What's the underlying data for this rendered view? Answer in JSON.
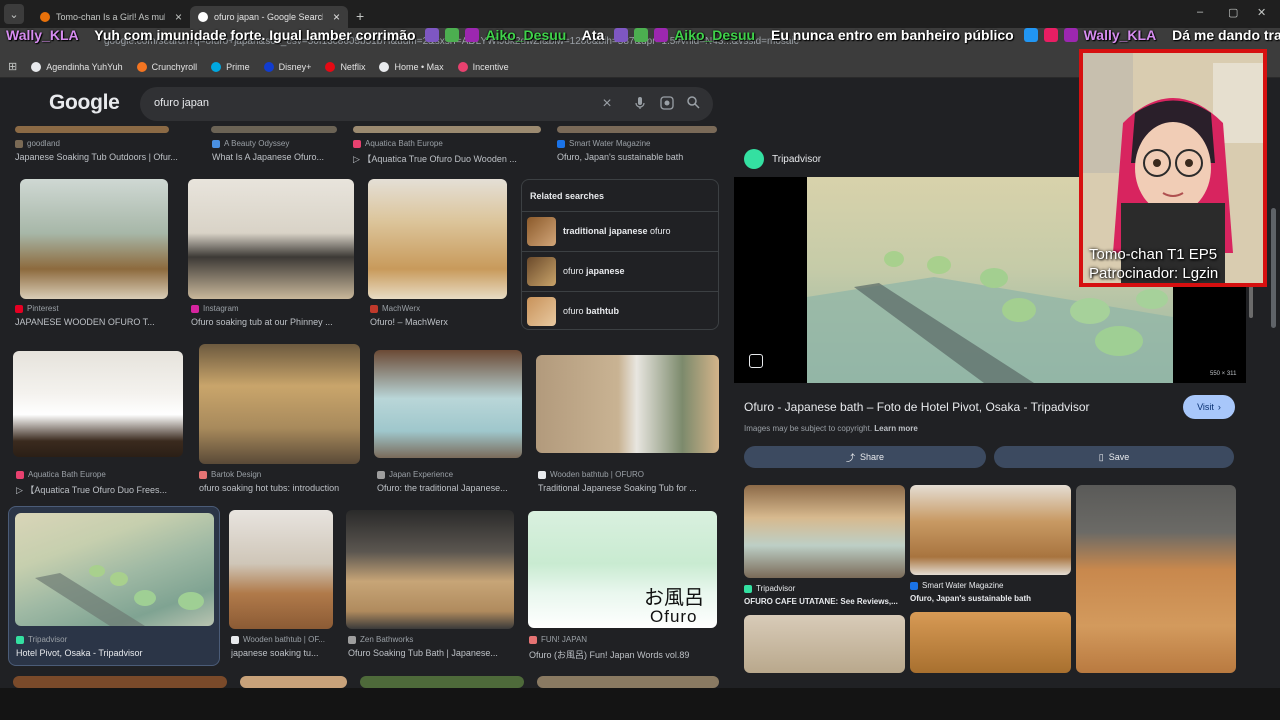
{
  "browser": {
    "tabs": [
      {
        "title": "Tomo-chan Is a Girl! As mulhere",
        "close": "×",
        "favicon_color": "#e8710a"
      },
      {
        "title": "ofuro japan - Google Search",
        "close": "×",
        "favicon_color": "#ffffff"
      }
    ],
    "new_tab": "+",
    "url": "google.com/search?q=ofuro+japan&sca_esv=50f13c8605b51b7f&udm=2&sxsrf=ADLYWIJ8k2dwZf&biw=1280&bih=587&dpr=1.5#vhid=N43...&vssid=mosaic",
    "window_controls": {
      "minimize": "–",
      "maximize": "▢",
      "close": "✕"
    },
    "bookmarks": [
      {
        "label": "Agendinha YuhYuh",
        "color": "#e8eaed"
      },
      {
        "label": "Crunchyroll",
        "color": "#f47521"
      },
      {
        "label": "Prime",
        "color": "#00a8e1"
      },
      {
        "label": "Disney+",
        "color": "#113ccf"
      },
      {
        "label": "Netflix",
        "color": "#e50914"
      },
      {
        "label": "Home • Max",
        "color": "#e8eaed"
      },
      {
        "label": "Incentive",
        "color": "#e8416f"
      }
    ]
  },
  "chat": [
    {
      "user": "Wally_KLA",
      "text": "Yuh com imunidade forte. Igual lamber corrimão",
      "user_class": "uname1"
    },
    {
      "user": "Aiko_Desuu",
      "text": "Ata",
      "user_class": "uname2"
    },
    {
      "user": "Aiko_Desuu",
      "text": "Eu nunca entro em banheiro público",
      "user_class": "uname2"
    },
    {
      "user": "Wally_KLA",
      "text": "Dá me dando trauma kkkkkk",
      "user_class": "uname1"
    }
  ],
  "search": {
    "logo": "Google",
    "query": "ofuro japan",
    "clear_icon": "×",
    "voice_icon": "🎤",
    "lens_icon": "⌖",
    "search_icon": "⌕"
  },
  "results": {
    "top_row": [
      {
        "source": "goodland",
        "caption": "Japanese Soaking Tub Outdoors | Ofur...",
        "color": "#7a6a55"
      },
      {
        "source": "A Beauty Odyssey",
        "caption": "What Is A Japanese Ofuro...",
        "color": "#4a90e2"
      },
      {
        "source": "Aquatica Bath Europe",
        "caption": "▷ 【Aquatica True Ofuro Duo Wooden ...",
        "color": "#e8416f"
      },
      {
        "source": "Smart Water Magazine",
        "caption": "Ofuro, Japan's sustainable bath",
        "color": "#1a73e8"
      }
    ],
    "row1": [
      {
        "source": "Pinterest",
        "caption": "JAPANESE WOODEN OFURO T...",
        "color": "#e60023"
      },
      {
        "source": "Instagram",
        "caption": "Ofuro soaking tub at our Phinney ...",
        "color": "#d6249f"
      },
      {
        "source": "MachWerx",
        "caption": "Ofuro! – MachWerx",
        "color": "#c0392b"
      }
    ],
    "related": {
      "title": "Related searches",
      "items": [
        {
          "bold": "traditional japanese",
          "plain": " ofuro"
        },
        {
          "plain": "ofuro ",
          "bold": "japanese"
        },
        {
          "plain": "ofuro ",
          "bold": "bathtub"
        }
      ]
    },
    "row2": [
      {
        "source": "Aquatica Bath Europe",
        "caption": "▷ 【Aquatica True Ofuro Duo Frees...",
        "color": "#e8416f"
      },
      {
        "source": "Bartok Design",
        "caption": "ofuro soaking hot tubs: introduction",
        "color": "#e57373"
      },
      {
        "source": "Japan Experience",
        "caption": "Ofuro: the traditional Japanese...",
        "color": "#9e9e9e"
      },
      {
        "source": "Wooden bathtub | OFURO",
        "caption": "Traditional Japanese Soaking Tub for ...",
        "color": "#e8eaed"
      }
    ],
    "row3": [
      {
        "source": "Tripadvisor",
        "caption": "Hotel Pivot, Osaka - Tripadvisor",
        "color": "#34e0a1"
      },
      {
        "source": "Wooden bathtub | OF...",
        "caption": "japanese soaking tu...",
        "color": "#e8eaed"
      },
      {
        "source": "Zen Bathworks",
        "caption": "Ofuro Soaking Tub Bath | Japanese...",
        "color": "#9e9e9e"
      },
      {
        "source": "FUN! JAPAN",
        "caption": "Ofuro (お風呂) Fun! Japan Words vol.89",
        "color": "#e57373"
      }
    ],
    "ofuro_jp": "お風呂",
    "ofuro_en": "Ofuro"
  },
  "preview": {
    "source": "Tripadvisor",
    "dimensions": "550 × 311",
    "title": "Ofuro - Japanese bath – Foto de Hotel Pivot, Osaka - Tripadvisor",
    "visit": "Visit",
    "copyright": "Images may be subject to copyright.",
    "learn_more": "Learn more",
    "share": "Share",
    "save": "Save",
    "related": [
      {
        "source": "Tripadvisor",
        "caption": "OFURO CAFE UTATANE: See Reviews,...",
        "color": "#34e0a1"
      },
      {
        "source": "Smart Water Magazine",
        "caption": "Ofuro, Japan's sustainable bath",
        "color": "#1a73e8"
      }
    ]
  },
  "webcam": {
    "line1": "Tomo-chan T1 EP5",
    "line2": "Patrocinador: Lgzin"
  }
}
